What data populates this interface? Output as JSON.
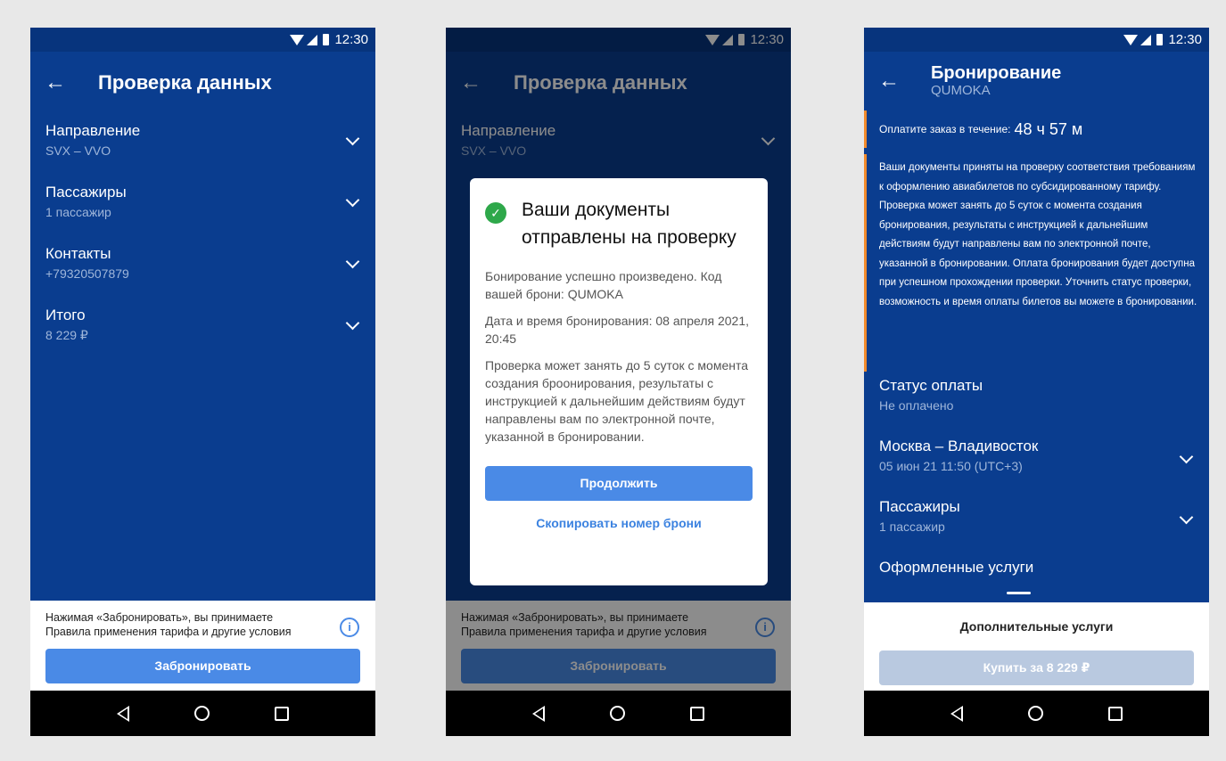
{
  "status": {
    "time": "12:30"
  },
  "screen1": {
    "title": "Проверка данных",
    "sections": [
      {
        "label": "Направление",
        "value": "SVX – VVO"
      },
      {
        "label": "Пассажиры",
        "value": "1 пассажир"
      },
      {
        "label": "Контакты",
        "value": "+79320507879"
      },
      {
        "label": "Итого",
        "value": "8 229 ₽"
      }
    ],
    "terms": "Нажимая «Забронировать», вы принимаете Правила применения тарифа и другие условия",
    "book_button": "Забронировать"
  },
  "screen2": {
    "title": "Проверка данных",
    "sections": [
      {
        "label": "Направление",
        "value": "SVX – VVO"
      }
    ],
    "dialog": {
      "title": "Ваши документы отправлены на проверку",
      "text1": "Бонирование успешно произведено. Код вашей брони: QUMOKA",
      "text2": "Дата и время бронирования: 08 апреля 2021, 20:45",
      "text3": "Проверка может занять до 5 суток с момента создания броонирования, результаты с инструкцией к дальнейшим действиям будут направлены вам по электронной почте, указанной в бронировании.",
      "continue_button": "Продолжить",
      "copy_link": "Скопировать номер брони"
    },
    "terms": "Нажимая «Забронировать», вы принимаете Правила применения тарифа и другие условия",
    "book_button": "Забронировать"
  },
  "screen3": {
    "title": "Бронирование",
    "subtitle": "QUMOKA",
    "pay_label": "Оплатите заказ в течение:",
    "pay_time": "48 ч 57 м",
    "notice": "Ваши документы приняты на проверку соответствия требованиям к оформлению авиабилетов по субсидированному  тарифу. Проверка может занять до 5 суток с момента создания бронирования, результаты с инструкцией к дальнейшим действиям будут направлены вам по электронной почте, указанной в бронировании. Оплата бронирования будет доступна при успешном прохождении проверки. Уточнить статус проверки, возможность и время оплаты билетов вы можете в бронировании.",
    "payment_status": {
      "label": "Статус оплаты",
      "value": "Не оплачено"
    },
    "route": {
      "label": "Москва – Владивосток",
      "value": "05 июн 21   11:50 (UTC+3)"
    },
    "passengers": {
      "label": "Пассажиры",
      "value": "1 пассажир"
    },
    "services": {
      "label": "Оформленные услуги"
    },
    "extra_services": "Дополнительные услуги",
    "buy_button": "Купить за 8 229 ₽"
  },
  "colors": {
    "primary": "#0a3d8f",
    "accent": "#4a8ae6",
    "warning": "#f28b2c",
    "success": "#2ea84a"
  }
}
